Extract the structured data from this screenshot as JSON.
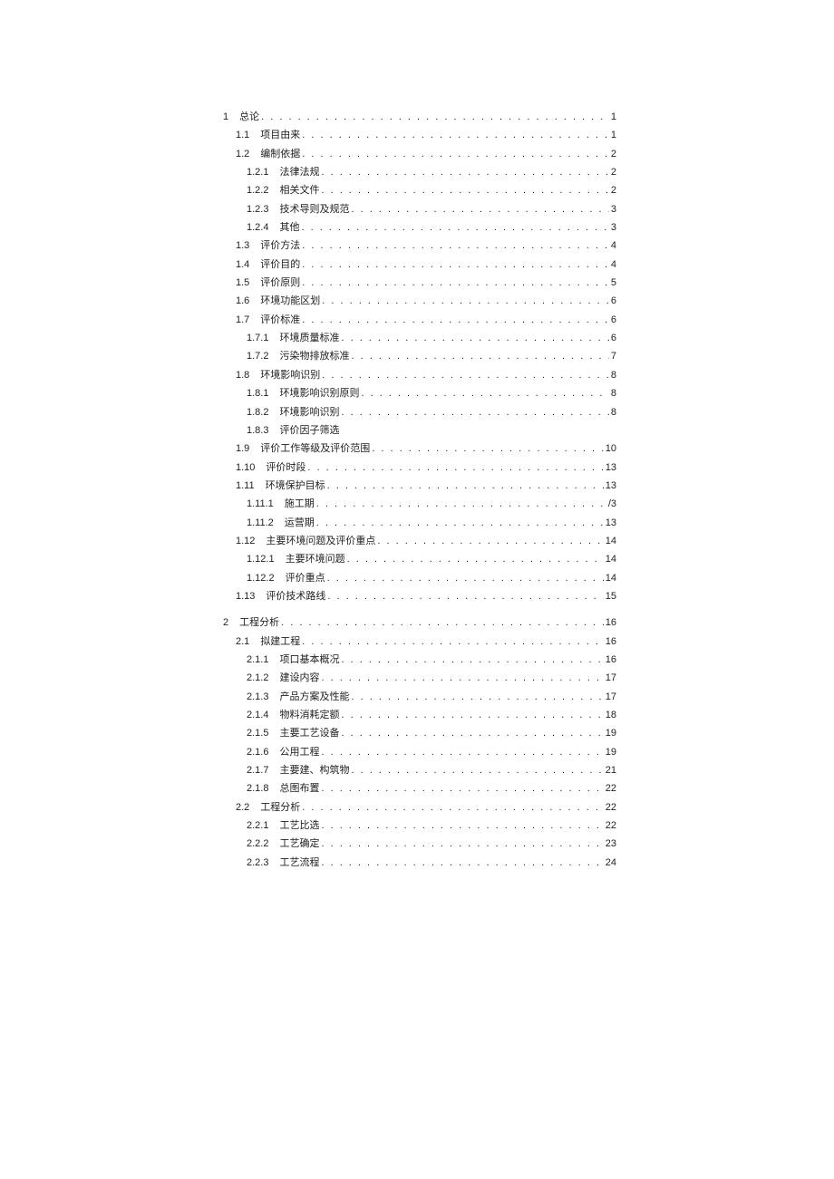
{
  "toc": [
    {
      "level": 1,
      "num": "1",
      "title": "总论",
      "page": "1"
    },
    {
      "level": 2,
      "num": "1.1",
      "title": "项目由来",
      "page": "1"
    },
    {
      "level": 2,
      "num": "1.2",
      "title": "编制依据",
      "page": "2"
    },
    {
      "level": 3,
      "num": "1.2.1",
      "title": "法律法规",
      "page": "2"
    },
    {
      "level": 3,
      "num": "1.2.2",
      "title": "相关文件",
      "page": "2"
    },
    {
      "level": 3,
      "num": "1.2.3",
      "title": "技术导则及规范",
      "page": "3"
    },
    {
      "level": 3,
      "num": "1.2.4",
      "title": "其他",
      "page": "3"
    },
    {
      "level": 2,
      "num": "1.3",
      "title": "评价方法",
      "page": "4"
    },
    {
      "level": 2,
      "num": "1.4",
      "title": "评价目的",
      "page": "4"
    },
    {
      "level": 2,
      "num": "1.5",
      "title": "评价原则",
      "page": "5"
    },
    {
      "level": 2,
      "num": "1.6",
      "title": "环境功能区划",
      "page": "6"
    },
    {
      "level": 2,
      "num": "1.7",
      "title": "评价标准",
      "page": "6"
    },
    {
      "level": 3,
      "num": "1.7.1",
      "title": "环境质量标准",
      "page": "6"
    },
    {
      "level": 3,
      "num": "1.7.2",
      "title": "污染物排放标准",
      "page": "7"
    },
    {
      "level": 2,
      "num": "1.8",
      "title": "环境影响识别",
      "page": "8"
    },
    {
      "level": 3,
      "num": "1.8.1",
      "title": "环境影响识别原则",
      "page": "8"
    },
    {
      "level": 3,
      "num": "1.8.2",
      "title": "环境影响识别",
      "page": "8"
    },
    {
      "level": 3,
      "num": "1.8.3",
      "title": "评价因子筛选",
      "page": ""
    },
    {
      "level": 2,
      "num": "1.9",
      "title": "评价工作等级及评价范围",
      "page": "10"
    },
    {
      "level": 2,
      "num": "1.10",
      "title": "评价时段",
      "page": "13"
    },
    {
      "level": 2,
      "num": "1.11",
      "title": "环境保护目标",
      "page": "13"
    },
    {
      "level": 3,
      "num": "1.11.1",
      "title": "施工期",
      "page": "/3"
    },
    {
      "level": 3,
      "num": "1.11.2",
      "title": "运营期",
      "page": "13"
    },
    {
      "level": 2,
      "num": "1.12",
      "title": "主要环境问题及评价重点",
      "page": "14"
    },
    {
      "level": 3,
      "num": "1.12.1",
      "title": "主要环境问题",
      "page": "14"
    },
    {
      "level": 3,
      "num": "1.12.2",
      "title": "评价重点",
      "page": "14"
    },
    {
      "level": 2,
      "num": "1.13",
      "title": "评价技术路线",
      "page": "15"
    },
    {
      "level": 1,
      "num": "2",
      "title": "工程分析",
      "page": "16"
    },
    {
      "level": 2,
      "num": "2.1",
      "title": "拟建工程",
      "page": "16"
    },
    {
      "level": 3,
      "num": "2.1.1",
      "title": "项口基本概况",
      "page": "16"
    },
    {
      "level": 3,
      "num": "2.1.2",
      "title": "建设内容",
      "page": "17"
    },
    {
      "level": 3,
      "num": "2.1.3",
      "title": "产品方案及性能",
      "page": "17"
    },
    {
      "level": 3,
      "num": "2.1.4",
      "title": "物料消耗定额",
      "page": "18"
    },
    {
      "level": 3,
      "num": "2.1.5",
      "title": "主要工艺设备",
      "page": "19"
    },
    {
      "level": 3,
      "num": "2.1.6",
      "title": "公用工程",
      "page": "19"
    },
    {
      "level": 3,
      "num": "2.1.7",
      "title": "主要建、构筑物",
      "page": "21"
    },
    {
      "level": 3,
      "num": "2.1.8",
      "title": "总图布置",
      "page": "22"
    },
    {
      "level": 2,
      "num": "2.2",
      "title": "工程分析",
      "page": "22"
    },
    {
      "level": 3,
      "num": "2.2.1",
      "title": "工艺比选",
      "page": "22"
    },
    {
      "level": 3,
      "num": "2.2.2",
      "title": "工艺确定",
      "page": "23"
    },
    {
      "level": 3,
      "num": "2.2.3",
      "title": "工艺流程",
      "page": "24"
    }
  ]
}
